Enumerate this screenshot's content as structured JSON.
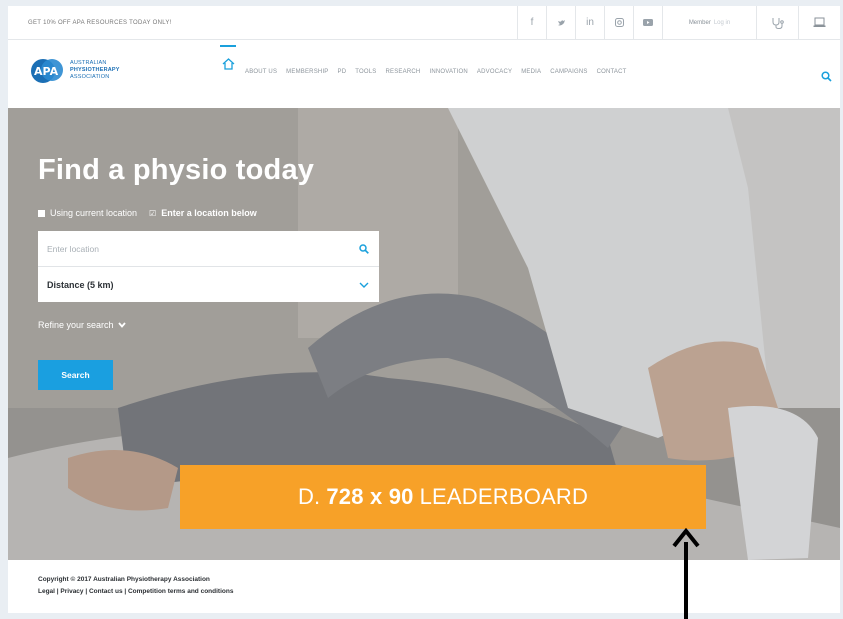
{
  "topbar": {
    "promo": "GET 10% OFF APA RESOURCES TODAY ONLY!",
    "social": [
      "facebook-icon",
      "twitter-icon",
      "linkedin-icon",
      "instagram-icon",
      "youtube-icon"
    ],
    "social_glyphs": [
      "f",
      "•",
      "in",
      "▣",
      "▶"
    ],
    "member_label": "Member",
    "login_label": "Log in",
    "icons": [
      "stethoscope-icon",
      "laptop-icon"
    ]
  },
  "nav": {
    "logo_text": [
      "AUSTRALIAN",
      "PHYSIOTHERAPY",
      "ASSOCIATION"
    ],
    "items": [
      "ABOUT US",
      "MEMBERSHIP",
      "PD",
      "TOOLS",
      "RESEARCH",
      "INNOVATION",
      "ADVOCACY",
      "MEDIA",
      "CAMPAIGNS",
      "CONTACT"
    ]
  },
  "hero": {
    "title": "Find a physio today",
    "option_current": "Using current location",
    "option_enter": "Enter a location below",
    "location_placeholder": "Enter location",
    "distance_value": "Distance (5 km)",
    "refine_label": "Refine your search",
    "search_button": "Search"
  },
  "leaderboard": {
    "prefix": "D.",
    "size": "728 x 90",
    "label": "LEADERBOARD"
  },
  "footer": {
    "copyright": "Copyright © 2017 Australian Physiotherapy Association",
    "links": "Legal | Privacy | Contact us | Competition terms and conditions"
  },
  "colors": {
    "accent_blue": "#1a9fe0",
    "leaderboard_orange": "#f7a128",
    "logo_blue": "#1b6fb5"
  }
}
